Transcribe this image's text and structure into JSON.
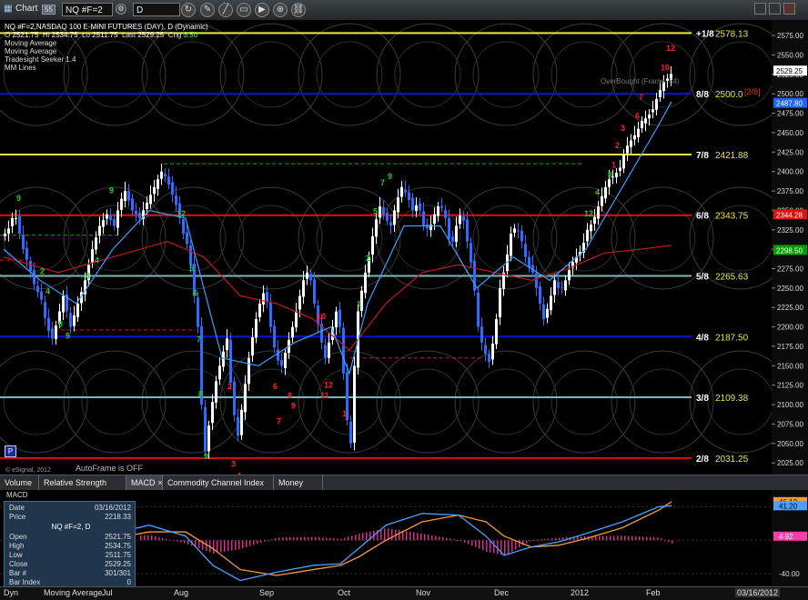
{
  "window": {
    "title": "Chart",
    "badge": "55",
    "symbol": "NQ #F=2",
    "interval": "D"
  },
  "legend": {
    "line1": "NQ #F=2,NASDAQ 100 E-MINI FUTURES (DAY), D (Dynamic)",
    "o_label": "O",
    "o_value": "2521.75",
    "hi_label": "Hi",
    "hi_value": "2534.75",
    "lo_label": "Lo",
    "lo_value": "2511.75",
    "last_label": "Last",
    "last_value": "2529.25",
    "chg_label": "Chg",
    "chg_value": "3.50",
    "studies": [
      "Moving Average",
      "Moving Average",
      "Tradesight Seeker 1.4",
      "MM Lines"
    ]
  },
  "annotations": {
    "overbought": "OverBought (Frame: 64)",
    "autoframe": "AutoFrame is OFF",
    "esignal": "© eSignal, 2012",
    "p_button": "P",
    "tag_28": "[2/8]"
  },
  "tabs": [
    "Volume",
    "Relative Strength Index",
    "MACD",
    "Commodity Channel Index (CCI)",
    "Money Flow"
  ],
  "info_panel": {
    "title": "MACD",
    "date_label": "Date",
    "date_value": "03/16/2012",
    "price_label": "Price",
    "price_value": "2218.33",
    "symbol": "NQ #F=2, D",
    "rows": [
      {
        "k": "Open",
        "v": "2521.75"
      },
      {
        "k": "High",
        "v": "2534.75"
      },
      {
        "k": "Low",
        "v": "2511.75"
      },
      {
        "k": "Close",
        "v": "2529.25"
      },
      {
        "k": "Bar #",
        "v": "301/301"
      },
      {
        "k": "Bar Index",
        "v": "0"
      }
    ],
    "footer": "Moving Average",
    "footer_left": "Dyn",
    "footer_right": "Jul"
  },
  "x_axis": {
    "labels": [
      "Aug",
      "Sep",
      "Oct",
      "Nov",
      "Dec",
      "2012",
      "Feb"
    ],
    "right_date": "03/16/2012"
  },
  "colors": {
    "blue": "#0a14d8",
    "red": "#e01010",
    "yellow": "#e8e840",
    "teal": "#7ab8b8",
    "green": "#00b000"
  },
  "chart_data": [
    {
      "type": "candlestick",
      "title": "NQ #F=2,NASDAQ 100 E-MINI FUTURES (DAY), D (Dynamic)",
      "y_ticks": [
        2025,
        2050,
        2075,
        2100,
        2125,
        2150,
        2175,
        2200,
        2225,
        2250,
        2275,
        2300,
        2325,
        2350,
        2375,
        2400,
        2425,
        2450,
        2475,
        2500,
        2525,
        2550,
        2575
      ],
      "ylim": [
        2010,
        2595
      ],
      "murrey_lines": [
        {
          "label": "+1/8",
          "value": 2578.13,
          "value_label": "2578.13",
          "color": "#e8e840"
        },
        {
          "label": "8/8",
          "value": 2500.0,
          "value_label": "2500.0",
          "color": "#0a14d8"
        },
        {
          "label": "7/8",
          "value": 2421.88,
          "value_label": "2421.88",
          "color": "#e8e840"
        },
        {
          "label": "6/8",
          "value": 2343.75,
          "value_label": "2343.75",
          "color": "#e01010"
        },
        {
          "label": "5/8",
          "value": 2265.63,
          "value_label": "2265.63",
          "color": "#7ab8b8"
        },
        {
          "label": "4/8",
          "value": 2187.5,
          "value_label": "2187.50",
          "color": "#0a14d8"
        },
        {
          "label": "3/8",
          "value": 2109.38,
          "value_label": "2109.38",
          "color": "#7ab8b8"
        },
        {
          "label": "2/8",
          "value": 2031.25,
          "value_label": "2031.25",
          "color": "#e01010"
        }
      ],
      "price_tags": [
        {
          "value": 2529.25,
          "label": "2529.25",
          "bg": "#ffffff",
          "fg": "#000000"
        },
        {
          "value": 2487.8,
          "label": "2487.80",
          "bg": "#1e64ff",
          "fg": "#ffffff"
        },
        {
          "value": 2344.28,
          "label": "2344.28",
          "bg": "#e01010",
          "fg": "#ffffff"
        },
        {
          "value": 2298.5,
          "label": "2298.50",
          "bg": "#00a000",
          "fg": "#ffffff"
        }
      ],
      "close_path": [
        [
          0,
          2320
        ],
        [
          6,
          2330
        ],
        [
          10,
          2350
        ],
        [
          16,
          2320
        ],
        [
          20,
          2300
        ],
        [
          26,
          2280
        ],
        [
          32,
          2255
        ],
        [
          40,
          2235
        ],
        [
          46,
          2200
        ],
        [
          52,
          2185
        ],
        [
          58,
          2210
        ],
        [
          64,
          2240
        ],
        [
          72,
          2200
        ],
        [
          80,
          2230
        ],
        [
          88,
          2260
        ],
        [
          96,
          2300
        ],
        [
          104,
          2330
        ],
        [
          112,
          2345
        ],
        [
          120,
          2330
        ],
        [
          126,
          2360
        ],
        [
          132,
          2375
        ],
        [
          140,
          2350
        ],
        [
          148,
          2340
        ],
        [
          156,
          2360
        ],
        [
          164,
          2380
        ],
        [
          172,
          2400
        ],
        [
          178,
          2390
        ],
        [
          184,
          2370
        ],
        [
          190,
          2350
        ],
        [
          196,
          2320
        ],
        [
          202,
          2300
        ],
        [
          206,
          2260
        ],
        [
          212,
          2200
        ],
        [
          216,
          2100
        ],
        [
          220,
          2040
        ],
        [
          226,
          2090
        ],
        [
          232,
          2130
        ],
        [
          238,
          2160
        ],
        [
          244,
          2185
        ],
        [
          250,
          2100
        ],
        [
          256,
          2060
        ],
        [
          262,
          2110
        ],
        [
          268,
          2160
        ],
        [
          274,
          2200
        ],
        [
          280,
          2230
        ],
        [
          286,
          2250
        ],
        [
          292,
          2200
        ],
        [
          298,
          2160
        ],
        [
          304,
          2150
        ],
        [
          310,
          2175
        ],
        [
          316,
          2200
        ],
        [
          322,
          2230
        ],
        [
          328,
          2260
        ],
        [
          334,
          2275
        ],
        [
          340,
          2230
        ],
        [
          346,
          2190
        ],
        [
          352,
          2160
        ],
        [
          358,
          2190
        ],
        [
          364,
          2220
        ],
        [
          368,
          2200
        ],
        [
          372,
          2140
        ],
        [
          376,
          2080
        ],
        [
          380,
          2050
        ],
        [
          384,
          2150
        ],
        [
          388,
          2220
        ],
        [
          394,
          2260
        ],
        [
          400,
          2290
        ],
        [
          406,
          2330
        ],
        [
          412,
          2355
        ],
        [
          418,
          2340
        ],
        [
          424,
          2330
        ],
        [
          430,
          2360
        ],
        [
          436,
          2380
        ],
        [
          442,
          2370
        ],
        [
          448,
          2350
        ],
        [
          454,
          2360
        ],
        [
          460,
          2330
        ],
        [
          466,
          2325
        ],
        [
          472,
          2345
        ],
        [
          478,
          2360
        ],
        [
          484,
          2340
        ],
        [
          490,
          2300
        ],
        [
          496,
          2330
        ],
        [
          502,
          2350
        ],
        [
          508,
          2310
        ],
        [
          514,
          2270
        ],
        [
          520,
          2200
        ],
        [
          526,
          2170
        ],
        [
          532,
          2155
        ],
        [
          538,
          2190
        ],
        [
          544,
          2250
        ],
        [
          550,
          2280
        ],
        [
          556,
          2320
        ],
        [
          562,
          2330
        ],
        [
          568,
          2310
        ],
        [
          574,
          2280
        ],
        [
          580,
          2270
        ],
        [
          586,
          2240
        ],
        [
          592,
          2210
        ],
        [
          598,
          2230
        ],
        [
          604,
          2260
        ],
        [
          610,
          2245
        ],
        [
          616,
          2260
        ],
        [
          622,
          2280
        ],
        [
          628,
          2290
        ],
        [
          634,
          2300
        ],
        [
          640,
          2325
        ],
        [
          646,
          2335
        ],
        [
          652,
          2355
        ],
        [
          658,
          2375
        ],
        [
          664,
          2390
        ],
        [
          670,
          2395
        ],
        [
          676,
          2405
        ],
        [
          682,
          2430
        ],
        [
          688,
          2440
        ],
        [
          694,
          2450
        ],
        [
          700,
          2465
        ],
        [
          706,
          2470
        ],
        [
          712,
          2480
        ],
        [
          718,
          2500
        ],
        [
          724,
          2515
        ],
        [
          730,
          2522
        ],
        [
          734,
          2529
        ]
      ],
      "moving_average_fast": [
        [
          0,
          2300
        ],
        [
          40,
          2260
        ],
        [
          80,
          2230
        ],
        [
          120,
          2300
        ],
        [
          160,
          2350
        ],
        [
          200,
          2340
        ],
        [
          240,
          2160
        ],
        [
          280,
          2150
        ],
        [
          320,
          2180
        ],
        [
          360,
          2200
        ],
        [
          380,
          2140
        ],
        [
          400,
          2230
        ],
        [
          440,
          2330
        ],
        [
          480,
          2330
        ],
        [
          520,
          2250
        ],
        [
          560,
          2290
        ],
        [
          600,
          2260
        ],
        [
          640,
          2300
        ],
        [
          680,
          2380
        ],
        [
          720,
          2460
        ],
        [
          734,
          2490
        ]
      ],
      "moving_average_slow": [
        [
          0,
          2290
        ],
        [
          60,
          2270
        ],
        [
          120,
          2290
        ],
        [
          180,
          2310
        ],
        [
          220,
          2290
        ],
        [
          260,
          2240
        ],
        [
          300,
          2230
        ],
        [
          340,
          2210
        ],
        [
          380,
          2170
        ],
        [
          420,
          2230
        ],
        [
          460,
          2270
        ],
        [
          500,
          2280
        ],
        [
          540,
          2270
        ],
        [
          580,
          2260
        ],
        [
          620,
          2275
        ],
        [
          660,
          2295
        ],
        [
          700,
          2300
        ],
        [
          734,
          2305
        ]
      ],
      "seeker_counts": [
        {
          "label": "9",
          "x": 14,
          "v": 2362,
          "color": "green"
        },
        {
          "label": "2",
          "x": 40,
          "v": 2268,
          "color": "green"
        },
        {
          "label": "4",
          "x": 46,
          "v": 2242,
          "color": "green"
        },
        {
          "label": "8",
          "x": 60,
          "v": 2200,
          "color": "green"
        },
        {
          "label": "9",
          "x": 68,
          "v": 2185,
          "color": "green"
        },
        {
          "label": "3",
          "x": 90,
          "v": 2262,
          "color": "green"
        },
        {
          "label": "4",
          "x": 100,
          "v": 2282,
          "color": "green"
        },
        {
          "label": "9",
          "x": 116,
          "v": 2372,
          "color": "green"
        },
        {
          "label": "12",
          "x": 190,
          "v": 2342,
          "color": "green"
        },
        {
          "label": "5",
          "x": 204,
          "v": 2272,
          "color": "green"
        },
        {
          "label": "6",
          "x": 208,
          "v": 2240,
          "color": "green"
        },
        {
          "label": "7",
          "x": 212,
          "v": 2180,
          "color": "green"
        },
        {
          "label": "8",
          "x": 214,
          "v": 2110,
          "color": "green"
        },
        {
          "label": "9",
          "x": 220,
          "v": 2030,
          "color": "green"
        },
        {
          "label": "2",
          "x": 246,
          "v": 2120,
          "color": "red"
        },
        {
          "label": "3",
          "x": 250,
          "v": 2020,
          "color": "red"
        },
        {
          "label": "4",
          "x": 256,
          "v": 2005,
          "color": "red"
        },
        {
          "label": "6",
          "x": 296,
          "v": 2120,
          "color": "red"
        },
        {
          "label": "7",
          "x": 300,
          "v": 2075,
          "color": "red"
        },
        {
          "label": "8",
          "x": 312,
          "v": 2108,
          "color": "red"
        },
        {
          "label": "9",
          "x": 316,
          "v": 2095,
          "color": "red"
        },
        {
          "label": "10",
          "x": 344,
          "v": 2210,
          "color": "red"
        },
        {
          "label": "11",
          "x": 348,
          "v": 2108,
          "color": "red"
        },
        {
          "label": "12",
          "x": 352,
          "v": 2122,
          "color": "red"
        },
        {
          "label": "1",
          "x": 372,
          "v": 2085,
          "color": "red"
        },
        {
          "label": "1",
          "x": 388,
          "v": 2226,
          "color": "green"
        },
        {
          "label": "2",
          "x": 398,
          "v": 2285,
          "color": "green"
        },
        {
          "label": "5",
          "x": 406,
          "v": 2345,
          "color": "green"
        },
        {
          "label": "7",
          "x": 414,
          "v": 2382,
          "color": "green"
        },
        {
          "label": "9",
          "x": 422,
          "v": 2390,
          "color": "green"
        },
        {
          "label": "12",
          "x": 638,
          "v": 2342,
          "color": "green"
        },
        {
          "label": "4",
          "x": 650,
          "v": 2370,
          "color": "green"
        },
        {
          "label": "8",
          "x": 664,
          "v": 2392,
          "color": "green"
        },
        {
          "label": "1",
          "x": 668,
          "v": 2405,
          "color": "red"
        },
        {
          "label": "2",
          "x": 672,
          "v": 2430,
          "color": "red"
        },
        {
          "label": "3",
          "x": 678,
          "v": 2452,
          "color": "red"
        },
        {
          "label": "6",
          "x": 694,
          "v": 2468,
          "color": "red"
        },
        {
          "label": "7",
          "x": 698,
          "v": 2492,
          "color": "red"
        },
        {
          "label": "10",
          "x": 722,
          "v": 2530,
          "color": "red"
        },
        {
          "label": "12",
          "x": 728,
          "v": 2555,
          "color": "red"
        }
      ]
    },
    {
      "type": "line",
      "title": "MACD",
      "y_ticks": [
        40.0,
        -40.0
      ],
      "ylim": [
        -55,
        60
      ],
      "price_tags": [
        {
          "value": 46.12,
          "label": "46.12",
          "bg": "#f29a3a",
          "fg": "#000000"
        },
        {
          "value": 41.2,
          "label": "41.20",
          "bg": "#4aa0ff",
          "fg": "#000000"
        },
        {
          "value": 4.92,
          "label": "4.92",
          "bg": "#ff3da8",
          "fg": "#ffffff"
        }
      ],
      "macd_line": [
        [
          0,
          18
        ],
        [
          40,
          10
        ],
        [
          80,
          -5
        ],
        [
          120,
          8
        ],
        [
          160,
          18
        ],
        [
          200,
          5
        ],
        [
          230,
          -30
        ],
        [
          260,
          -48
        ],
        [
          300,
          -38
        ],
        [
          340,
          -30
        ],
        [
          370,
          -28
        ],
        [
          390,
          -10
        ],
        [
          420,
          18
        ],
        [
          460,
          32
        ],
        [
          500,
          30
        ],
        [
          530,
          5
        ],
        [
          550,
          -18
        ],
        [
          580,
          -8
        ],
        [
          610,
          -2
        ],
        [
          640,
          8
        ],
        [
          680,
          22
        ],
        [
          720,
          40
        ],
        [
          734,
          41.2
        ]
      ],
      "signal_line": [
        [
          0,
          15
        ],
        [
          40,
          14
        ],
        [
          80,
          5
        ],
        [
          120,
          2
        ],
        [
          160,
          10
        ],
        [
          200,
          10
        ],
        [
          230,
          -10
        ],
        [
          260,
          -35
        ],
        [
          300,
          -42
        ],
        [
          340,
          -35
        ],
        [
          370,
          -30
        ],
        [
          390,
          -20
        ],
        [
          420,
          0
        ],
        [
          460,
          22
        ],
        [
          500,
          30
        ],
        [
          530,
          22
        ],
        [
          550,
          5
        ],
        [
          580,
          -8
        ],
        [
          610,
          -6
        ],
        [
          640,
          2
        ],
        [
          680,
          15
        ],
        [
          720,
          36
        ],
        [
          734,
          46.12
        ]
      ]
    }
  ]
}
